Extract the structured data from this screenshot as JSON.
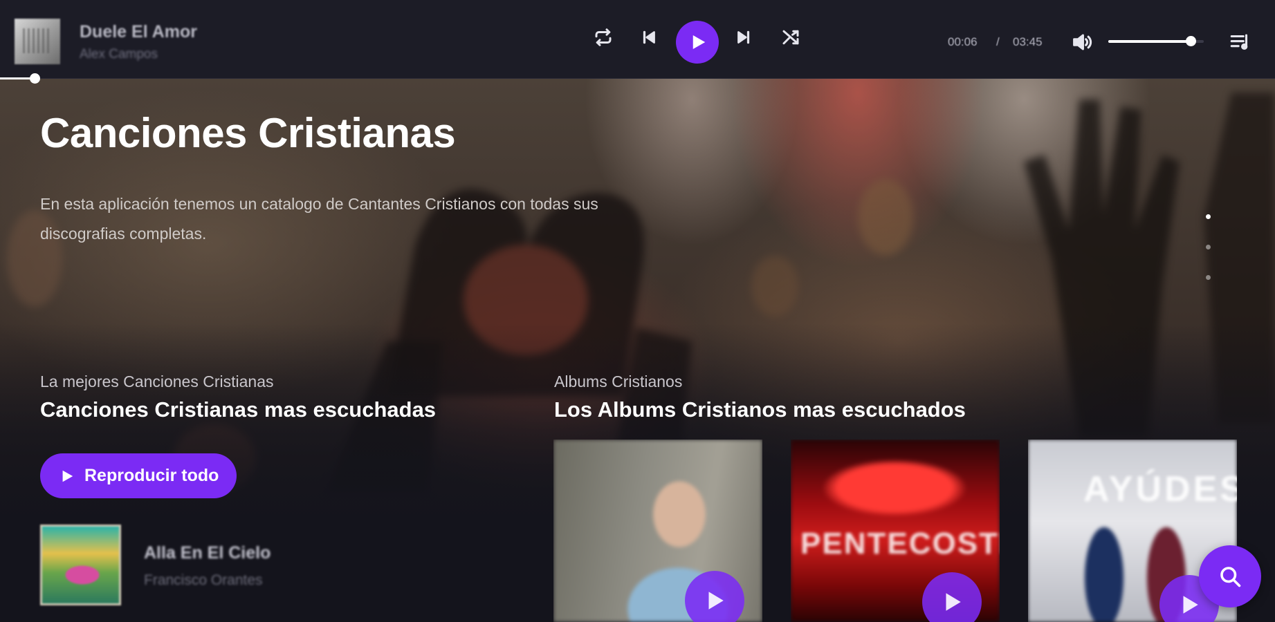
{
  "player": {
    "now_playing": {
      "title": "Duele El Amor",
      "artist": "Alex Campos"
    },
    "time": {
      "current": "00:06",
      "separator": "/",
      "total": "03:45"
    },
    "progress": 0.027,
    "volume": 0.86,
    "icons": [
      "repeat-icon",
      "previous-icon",
      "play-icon",
      "next-icon",
      "shuffle-icon",
      "volume-icon",
      "queue-icon"
    ],
    "accent": "#7b2bf4"
  },
  "hero": {
    "title": "Canciones Cristianas",
    "description": "En esta aplicación tenemos un catalogo de Cantantes Cristianos con todas sus discografias completas.",
    "slides": 3,
    "active_slide": 0
  },
  "songs": {
    "subtitle": "La mejores Canciones Cristianas",
    "title": "Canciones Cristianas mas escuchadas",
    "play_all_label": "Reproducir todo",
    "items": [
      {
        "title": "Alla En El Cielo",
        "artist": "Francisco Orantes"
      }
    ]
  },
  "albums": {
    "subtitle": "Albums Cristianos",
    "title": "Los Albums Cristianos mas escuchados",
    "items": [
      {
        "cover_text": ""
      },
      {
        "cover_text": "PENTECOSTÉS"
      },
      {
        "cover_text": "AYÚDES"
      }
    ]
  }
}
